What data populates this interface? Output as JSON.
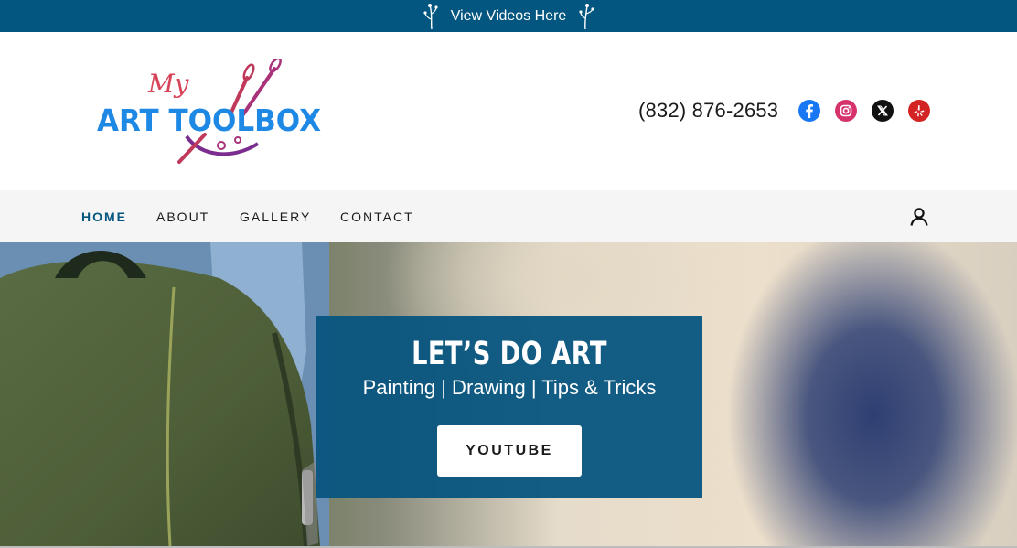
{
  "announcement": {
    "text": "View Videos Here"
  },
  "header": {
    "logo_script": "My",
    "logo_text": "ART TOOLBOX",
    "phone": "(832) 876-2653",
    "social": [
      {
        "name": "facebook-icon",
        "color": "#1877f2"
      },
      {
        "name": "instagram-icon",
        "color": "#e1306c"
      },
      {
        "name": "x-icon",
        "color": "#111111"
      },
      {
        "name": "yelp-icon",
        "color": "#d32323"
      }
    ]
  },
  "nav": {
    "items": [
      {
        "label": "HOME",
        "active": true
      },
      {
        "label": "ABOUT",
        "active": false
      },
      {
        "label": "GALLERY",
        "active": false
      },
      {
        "label": "CONTACT",
        "active": false
      }
    ],
    "account_icon": "user-icon"
  },
  "hero": {
    "title": "LET’S DO ART",
    "subtitle": "Painting | Drawing | Tips & Tricks",
    "button_label": "YOUTUBE"
  },
  "colors": {
    "brand": "#03567f",
    "logo_blue": "#1e88e5",
    "logo_red": "#c0392b"
  }
}
